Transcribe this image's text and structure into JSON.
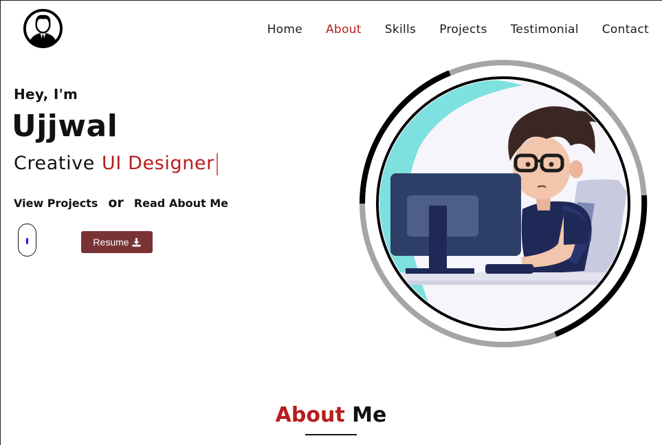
{
  "nav": {
    "items": [
      {
        "label": "Home"
      },
      {
        "label": "About"
      },
      {
        "label": "Skills"
      },
      {
        "label": "Projects"
      },
      {
        "label": "Testimonial"
      },
      {
        "label": "Contact"
      }
    ],
    "active": "About"
  },
  "hero": {
    "greeting": "Hey, I'm",
    "name": "Ujjwal",
    "role_prefix": "Creative",
    "role_typed": "UI Designer",
    "link_projects": "View Projects",
    "link_or": "or",
    "link_about": "Read About Me",
    "resume_label": "Resume"
  },
  "about": {
    "title_highlight": "About",
    "title_rest": "Me"
  },
  "colors": {
    "accent": "#b71c1c",
    "resume_button": "#7a3335",
    "scroll_wheel": "#1a1aff"
  },
  "icons": {
    "logo": "user-avatar-icon",
    "resume": "download-icon",
    "scroll": "mouse-scroll-icon"
  }
}
